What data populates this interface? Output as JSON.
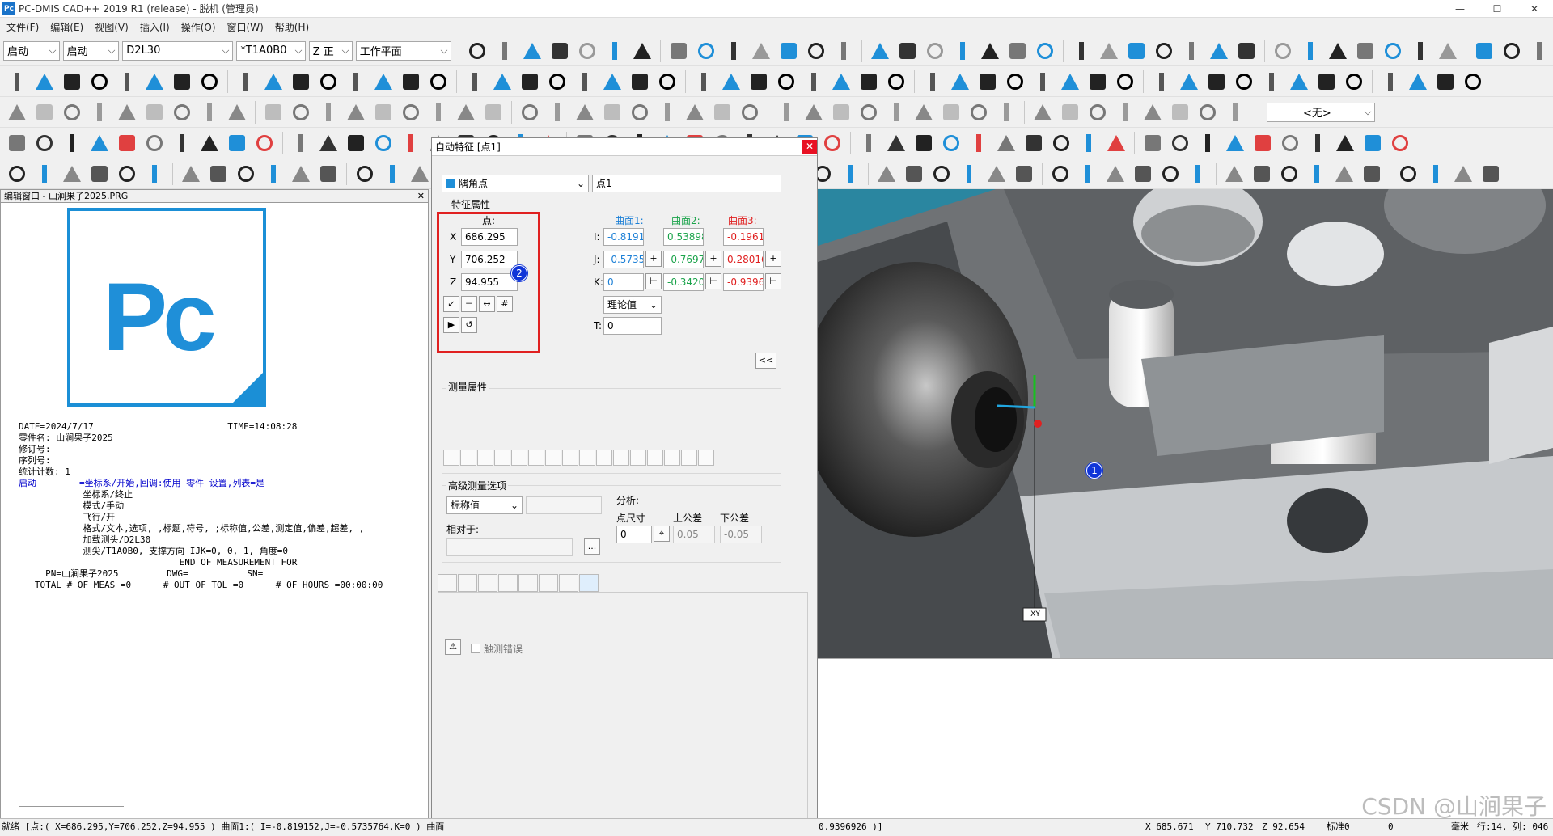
{
  "window": {
    "title": "PC-DMIS CAD++ 2019 R1 (release) - 脱机 (管理员)",
    "logo_text": "Pc"
  },
  "menu": [
    "文件(F)",
    "编辑(E)",
    "视图(V)",
    "插入(I)",
    "操作(O)",
    "窗口(W)",
    "帮助(H)"
  ],
  "toolbar": {
    "combos": [
      {
        "value": "启动"
      },
      {
        "value": "启动"
      },
      {
        "value": "D2L30"
      },
      {
        "value": "*T1A0B0"
      },
      {
        "value": "Z 正"
      },
      {
        "value": "工作平面"
      }
    ],
    "view_select": "<无>"
  },
  "editor": {
    "title": "编辑窗口 - 山涧果子2025.PRG",
    "lines": [
      "DATE=2024/7/17                         TIME=14:08:28",
      "零件名: 山涧果子2025",
      "修订号:",
      "序列号:",
      "统计计数: 1",
      "",
      "启动        =坐标系/开始,回调:使用_零件_设置,列表=是",
      "            坐标系/终止",
      "            模式/手动",
      "            飞行/开",
      "            格式/文本,选项, ,标题,符号, ;标称值,公差,测定值,偏差,超差, ,",
      "            加载测头/D2L30",
      "            测尖/T1A0B0, 支撑方向 IJK=0, 0, 1, 角度=0",
      "                              END OF MEASUREMENT FOR",
      "     PN=山涧果子2025         DWG=           SN=",
      "   TOTAL # OF MEAS =0      # OUT OF TOL =0      # OF HOURS =00:00:00"
    ]
  },
  "dialog": {
    "title": "自动特征 [点1]",
    "feature_type": "隅角点",
    "feature_name": "点1",
    "section_feature": "特征属性",
    "point_label": "点:",
    "x_label": "X",
    "y_label": "Y",
    "z_label": "Z",
    "x": "686.295",
    "y": "706.252",
    "z": "94.955",
    "surface1": "曲面1:",
    "surface2": "曲面2:",
    "surface3": "曲面3:",
    "i_label": "I:",
    "j_label": "J:",
    "k_label": "K:",
    "t_label": "T:",
    "s1": {
      "i": "-0.8191",
      "j": "-0.5735",
      "k": "0"
    },
    "s2": {
      "i": "0.53898",
      "j": "-0.7697",
      "k": "-0.3420"
    },
    "s3": {
      "i": "-0.1961",
      "j": "0.28016",
      "k": "-0.9396"
    },
    "theory_select": "理论值",
    "t_value": "0",
    "collapse_btn": "<<",
    "section_measure": "测量属性",
    "section_adv": "高级测量选项",
    "nominal_select": "标称值",
    "relative_label": "相对于:",
    "browse_btn": "...",
    "analysis_label": "分析:",
    "point_size_label": "点尺寸",
    "upper_tol_label": "上公差",
    "lower_tol_label": "下公差",
    "point_size": "0",
    "upper_tol": "0.05",
    "lower_tol": "-0.05",
    "probe_error_label": "触测错误",
    "badge": "2",
    "colors": {
      "s1": "#1b7fd6",
      "s2": "#1aa34a",
      "s3": "#e02020"
    }
  },
  "viewport": {
    "badge": "1",
    "plane_label": "XY"
  },
  "status": {
    "left": "就绪  [点:( X=686.295,Y=706.252,Z=94.955 ) 曲面1:( I=-0.819152,J=-0.5735764,K=0 )  曲面",
    "mid": "0.9396926 )]",
    "x": "X  685.671",
    "y": "Y  710.732",
    "z": "Z  92.654",
    "std": "标准0",
    "zero": "0",
    "unit": "毫米",
    "row": "行:14, 列: 046",
    "watermark": "CSDN @山涧果子"
  }
}
